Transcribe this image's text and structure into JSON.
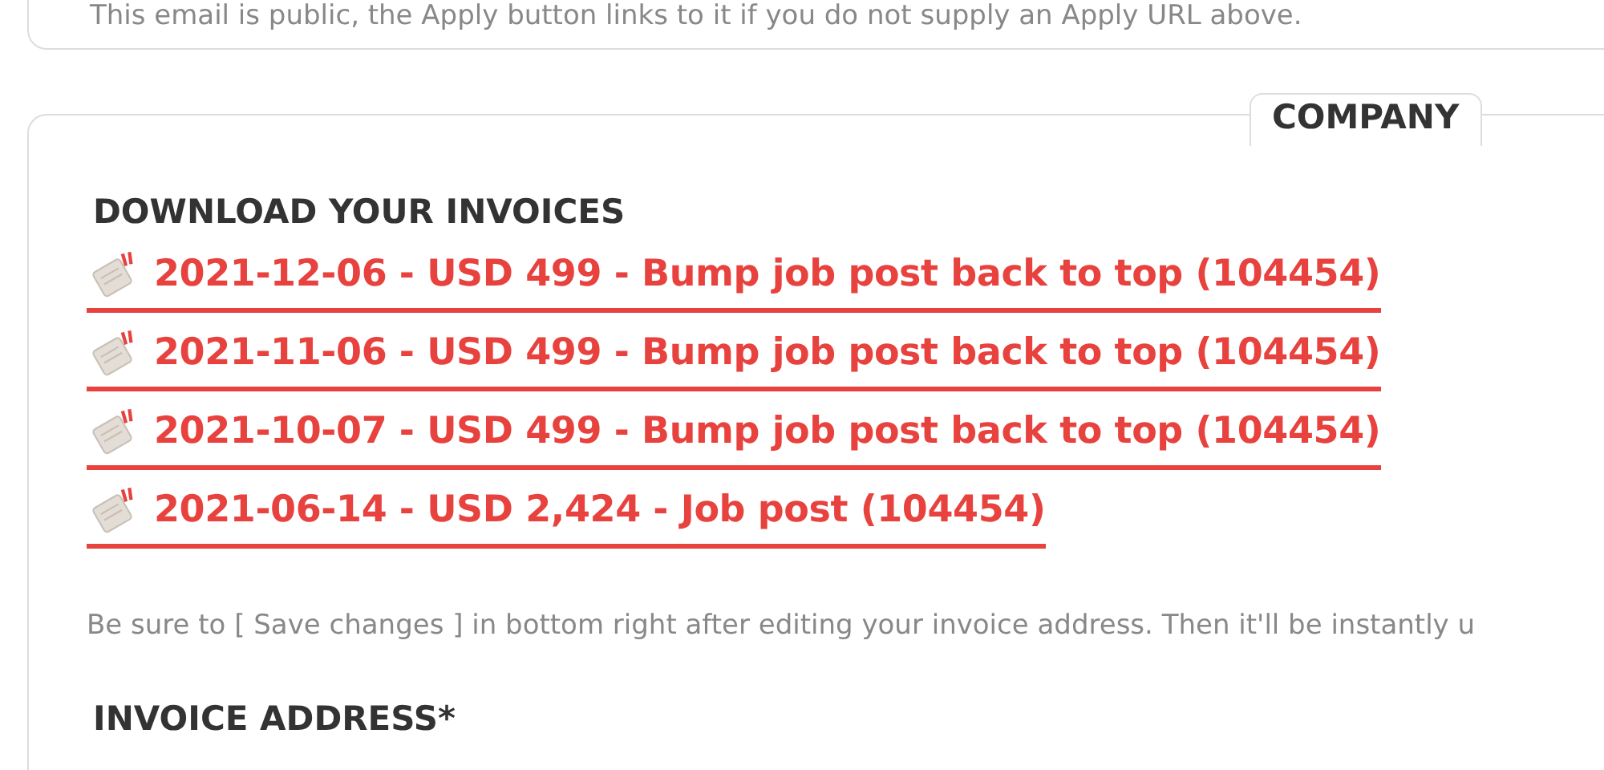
{
  "top_card": {
    "note": "This email is public, the Apply button links to it if you do not supply an Apply URL above."
  },
  "company_card": {
    "tab": "COMPANY",
    "invoices_heading": "DOWNLOAD YOUR INVOICES",
    "invoices": [
      {
        "label": "2021-12-06 - USD 499 - Bump job post back to top (104454)"
      },
      {
        "label": "2021-11-06 - USD 499 - Bump job post back to top (104454)"
      },
      {
        "label": "2021-10-07 - USD 499 - Bump job post back to top (104454)"
      },
      {
        "label": "2021-06-14 - USD 2,424 - Job post (104454)"
      }
    ],
    "note": "Be sure to [ Save changes ] in bottom right after editing your invoice address. Then it'll be instantly u",
    "address_heading": "INVOICE ADDRESS*"
  }
}
